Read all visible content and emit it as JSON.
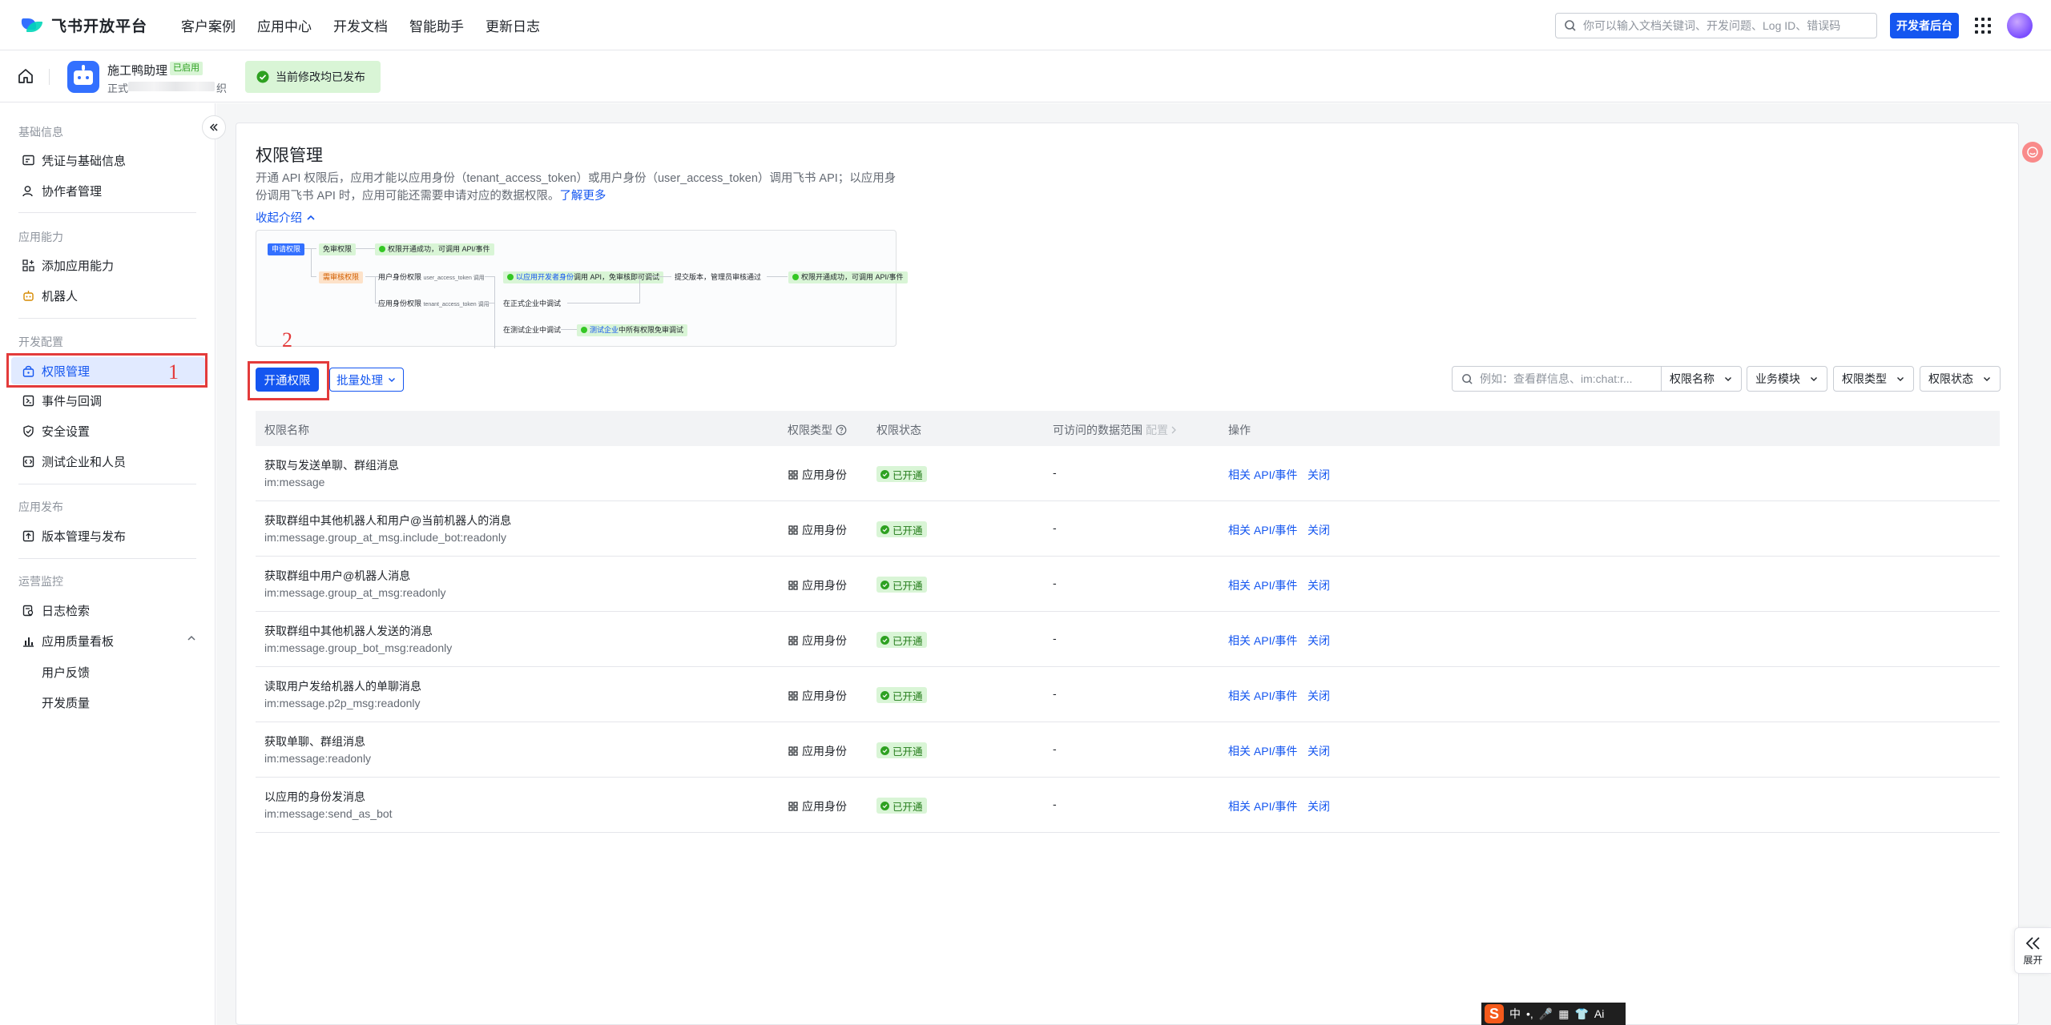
{
  "topnav": {
    "brand": "飞书开放平台",
    "links": [
      "客户案例",
      "应用中心",
      "开发文档",
      "智能助手",
      "更新日志"
    ],
    "search_placeholder": "你可以输入文档关键词、开发问题、Log ID、错误码",
    "dev_console": "开发者后台"
  },
  "appbar": {
    "app_name": "施工鸭助理",
    "app_badge": "已启用",
    "env_prefix": "正式",
    "env_suffix": "织",
    "publish_status": "当前修改均已发布"
  },
  "sidebar": {
    "groups": [
      {
        "title": "基础信息",
        "items": [
          "凭证与基础信息",
          "协作者管理"
        ]
      },
      {
        "title": "应用能力",
        "items": [
          "添加应用能力",
          "机器人"
        ]
      },
      {
        "title": "开发配置",
        "items": [
          "权限管理",
          "事件与回调",
          "安全设置",
          "测试企业和人员"
        ]
      },
      {
        "title": "应用发布",
        "items": [
          "版本管理与发布"
        ]
      },
      {
        "title": "运营监控",
        "items": [
          "日志检索",
          "应用质量看板"
        ]
      }
    ],
    "subitems": [
      "用户反馈",
      "开发质量"
    ]
  },
  "annotations": {
    "one": "1",
    "two": "2"
  },
  "main": {
    "title": "权限管理",
    "intro": "开通 API 权限后，应用才能以应用身份（tenant_access_token）或用户身份（user_access_token）调用飞书 API；以应用身份调用飞书 API 时，应用可能还需要申请对应的数据权限。",
    "learn_more": "了解更多",
    "fold": "收起介绍",
    "flow": {
      "apply": "申请权限",
      "free": "免审权限",
      "free_result": "权限开通成功，可调用 API/事件",
      "review": "需审核权限",
      "user_identity": "用户身份权限",
      "user_token": "user_access_token 调用",
      "app_identity": "应用身份权限",
      "tenant_token": "tenant_access_token 调用",
      "dev_call_hl": "以应用开发者身份",
      "dev_call_rest": "调用 API，免审核即可调试",
      "submit": "提交版本，管理员审核通过",
      "final": "权限开通成功，可调用 API/事件",
      "prod_debug": "在正式企业中调试",
      "test_debug": "在测试企业中调试",
      "test_hl": "测试企业",
      "test_rest": "中所有权限免审调试"
    },
    "open_btn": "开通权限",
    "batch_btn": "批量处理",
    "filter": {
      "search_placeholder": "例如：查看群信息、im:chat:r...",
      "selects": [
        "权限名称",
        "业务模块",
        "权限类型",
        "权限状态"
      ]
    },
    "table": {
      "columns": {
        "name": "权限名称",
        "type": "权限类型",
        "status": "权限状态",
        "scope": "可访问的数据范围",
        "scope_sub": "配置",
        "ops": "操作"
      },
      "rows": [
        {
          "name": "获取与发送单聊、群组消息",
          "key": "im:message",
          "type": "应用身份",
          "status": "已开通",
          "scope": "-",
          "api": "相关 API/事件",
          "close": "关闭"
        },
        {
          "name": "获取群组中其他机器人和用户@当前机器人的消息",
          "key": "im:message.group_at_msg.include_bot:readonly",
          "type": "应用身份",
          "status": "已开通",
          "scope": "-",
          "api": "相关 API/事件",
          "close": "关闭"
        },
        {
          "name": "获取群组中用户@机器人消息",
          "key": "im:message.group_at_msg:readonly",
          "type": "应用身份",
          "status": "已开通",
          "scope": "-",
          "api": "相关 API/事件",
          "close": "关闭"
        },
        {
          "name": "获取群组中其他机器人发送的消息",
          "key": "im:message.group_bot_msg:readonly",
          "type": "应用身份",
          "status": "已开通",
          "scope": "-",
          "api": "相关 API/事件",
          "close": "关闭"
        },
        {
          "name": "读取用户发给机器人的单聊消息",
          "key": "im:message.p2p_msg:readonly",
          "type": "应用身份",
          "status": "已开通",
          "scope": "-",
          "api": "相关 API/事件",
          "close": "关闭"
        },
        {
          "name": "获取单聊、群组消息",
          "key": "im:message:readonly",
          "type": "应用身份",
          "status": "已开通",
          "scope": "-",
          "api": "相关 API/事件",
          "close": "关闭"
        },
        {
          "name": "以应用的身份发消息",
          "key": "im:message:send_as_bot",
          "type": "应用身份",
          "status": "已开通",
          "scope": "-",
          "api": "相关 API/事件",
          "close": "关闭"
        }
      ]
    }
  },
  "floating": {
    "expand": "展开"
  },
  "ime": {
    "items": [
      "中",
      "•,",
      "🎤",
      "▦",
      "👕",
      "Ai"
    ]
  },
  "colors": {
    "primary": "#1456f0",
    "active_bg": "#e1eaff",
    "success_bg": "#d9f5d6",
    "success": "#2ea121",
    "annotation": "#e33b3b"
  }
}
